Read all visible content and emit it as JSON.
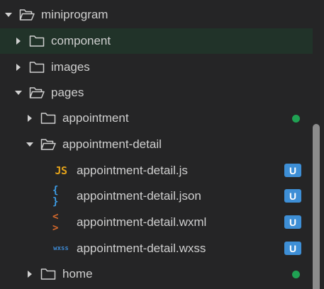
{
  "tree": {
    "root": {
      "label": "miniprogram",
      "expanded": true,
      "icon": "folder-open-icon"
    },
    "component": {
      "label": "component",
      "expanded": false,
      "icon": "folder-icon",
      "selected": true
    },
    "images": {
      "label": "images",
      "expanded": false,
      "icon": "folder-icon"
    },
    "pages": {
      "label": "pages",
      "expanded": true,
      "icon": "folder-open-icon"
    },
    "appointment": {
      "label": "appointment",
      "expanded": false,
      "icon": "folder-icon",
      "status": "modified-dot",
      "status_color": "#20a153"
    },
    "appointment_detail": {
      "label": "appointment-detail",
      "expanded": true,
      "icon": "folder-open-icon"
    },
    "files": [
      {
        "label": "appointment-detail.js",
        "type_icon": "JS",
        "icon": "js-file-icon",
        "badge": "U"
      },
      {
        "label": "appointment-detail.json",
        "type_icon": "{ }",
        "icon": "json-file-icon",
        "badge": "U"
      },
      {
        "label": "appointment-detail.wxml",
        "type_icon": "< >",
        "icon": "wxml-file-icon",
        "badge": "U"
      },
      {
        "label": "appointment-detail.wxss",
        "type_icon": "wxss",
        "icon": "wxss-file-icon",
        "badge": "U"
      }
    ],
    "home": {
      "label": "home",
      "expanded": false,
      "icon": "folder-icon",
      "status": "modified-dot",
      "status_color": "#20a153"
    }
  },
  "colors": {
    "background": "#252526",
    "selected_row": "#213329",
    "badge": "#3e8fd6",
    "dot": "#20a153",
    "js": "#e3a21a",
    "json": "#3d9ee8",
    "wxml": "#d86a2c",
    "wxss": "#3d8bd6"
  }
}
